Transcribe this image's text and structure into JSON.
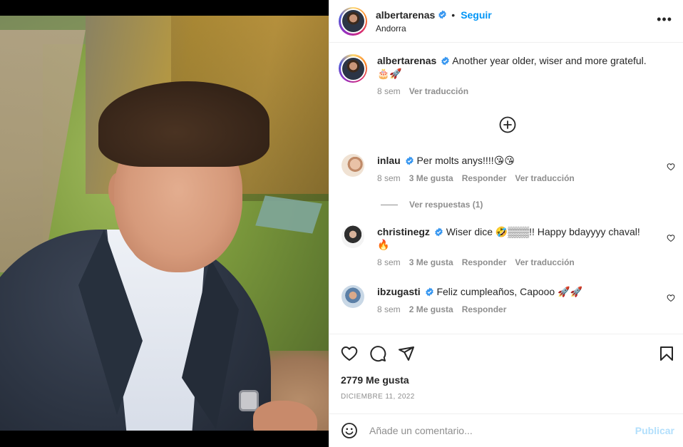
{
  "post": {
    "username": "albertarenas",
    "follow_label": "Seguir",
    "location": "Andorra",
    "more_icon": "more-horizontal-icon"
  },
  "caption": {
    "username": "albertarenas",
    "text": "Another year older, wiser and more grateful.",
    "emojis": "🎂🚀",
    "time": "8 sem",
    "translate": "Ver traducción"
  },
  "comments": [
    {
      "username": "inlau",
      "text": "Per molts anys!!!!",
      "emojis": "😘😘",
      "time": "8 sem",
      "likes": "3 Me gusta",
      "reply": "Responder",
      "translate": "Ver traducción"
    },
    {
      "username": "christinegz",
      "text": "Wiser dice 🤣▒▒▒!! Happy bdayyyy chaval!",
      "emojis": "🔥",
      "time": "8 sem",
      "likes": "3 Me gusta",
      "reply": "Responder",
      "translate": "Ver traducción"
    },
    {
      "username": "ibzugasti",
      "text": "Feliz cumpleaños, Capooo",
      "emojis": "🚀🚀",
      "time": "8 sem",
      "likes": "2 Me gusta",
      "reply": "Responder"
    }
  ],
  "view_replies": "Ver respuestas (1)",
  "stats": {
    "likes": "2779 Me gusta",
    "date": "DICIEMBRE 11, 2022"
  },
  "comment_box": {
    "placeholder": "Añade un comentario...",
    "publish": "Publicar"
  },
  "colors": {
    "accent": "#0095f6",
    "publish_disabled": "#b2dffc",
    "verified": "#3897f0",
    "muted": "#8e8e8e"
  }
}
